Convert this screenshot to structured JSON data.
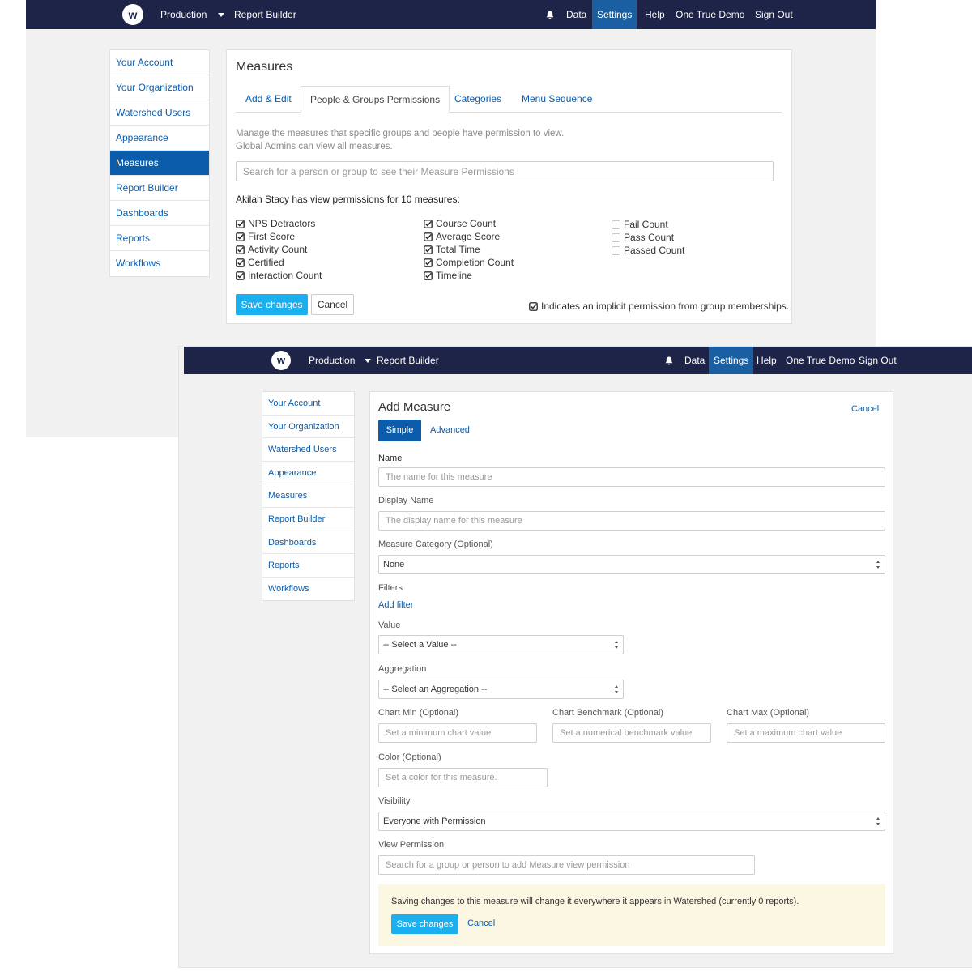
{
  "window1": {
    "navbar": {
      "logo": "w",
      "environment": "Production",
      "report_builder": "Report Builder",
      "data": "Data",
      "settings": "Settings",
      "help": "Help",
      "account": "One True Demo",
      "sign_out": "Sign Out"
    },
    "sidebar": {
      "items": [
        "Your Account",
        "Your Organization",
        "Watershed Users",
        "Appearance",
        "Measures",
        "Report Builder",
        "Dashboards",
        "Reports",
        "Workflows"
      ],
      "active": "Measures"
    },
    "panel": {
      "title": "Measures",
      "tabs": [
        "Add & Edit",
        "People & Groups Permissions",
        "Categories",
        "Menu Sequence"
      ],
      "active_tab": "People & Groups Permissions",
      "description_line1": "Manage the measures that specific groups and people have permission to view.",
      "description_line2": "Global Admins can view all measures.",
      "search_placeholder": "Search for a person or group to see their Measure Permissions",
      "summary": "Akilah Stacy has view permissions for 10 measures:",
      "columns": [
        {
          "items": [
            {
              "label": "NPS Detractors",
              "checked": true
            },
            {
              "label": "First Score",
              "checked": true
            },
            {
              "label": "Activity Count",
              "checked": true
            },
            {
              "label": "Certified",
              "checked": true
            },
            {
              "label": "Interaction Count",
              "checked": true
            }
          ]
        },
        {
          "items": [
            {
              "label": "Course Count",
              "checked": true
            },
            {
              "label": "Average Score",
              "checked": true
            },
            {
              "label": "Total Time",
              "checked": true
            },
            {
              "label": "Completion Count",
              "checked": true
            },
            {
              "label": "Timeline",
              "checked": true
            }
          ]
        },
        {
          "items": [
            {
              "label": "Fail Count",
              "checked": false
            },
            {
              "label": "Pass Count",
              "checked": false
            },
            {
              "label": "Passed Count",
              "checked": false
            }
          ]
        }
      ],
      "save_label": "Save changes",
      "cancel_label": "Cancel",
      "footnote": "Indicates an implicit permission from group memberships."
    }
  },
  "window2": {
    "navbar": {
      "logo": "w",
      "environment": "Production",
      "report_builder": "Report Builder",
      "data": "Data",
      "settings": "Settings",
      "help": "Help",
      "account": "One True Demo",
      "sign_out": "Sign Out"
    },
    "sidebar": {
      "items": [
        "Your Account",
        "Your Organization",
        "Watershed Users",
        "Appearance",
        "Measures",
        "Report Builder",
        "Dashboards",
        "Reports",
        "Workflows"
      ]
    },
    "form": {
      "title": "Add Measure",
      "cancel_top": "Cancel",
      "mode_simple": "Simple",
      "mode_advanced": "Advanced",
      "name_label": "Name",
      "name_placeholder": "The name for this measure",
      "display_name_label": "Display Name",
      "display_name_placeholder": "The display name for this measure",
      "category_label": "Measure Category (Optional)",
      "category_value": "None",
      "filters_label": "Filters",
      "add_filter": "Add filter",
      "value_label": "Value",
      "value_value": "-- Select a Value --",
      "aggregation_label": "Aggregation",
      "aggregation_value": "-- Select an Aggregation --",
      "chart_min_label": "Chart Min (Optional)",
      "chart_min_placeholder": "Set a minimum chart value",
      "chart_benchmark_label": "Chart Benchmark (Optional)",
      "chart_benchmark_placeholder": "Set a numerical benchmark value",
      "chart_max_label": "Chart Max (Optional)",
      "chart_max_placeholder": "Set a maximum chart value",
      "color_label": "Color (Optional)",
      "color_placeholder": "Set a color for this measure.",
      "visibility_label": "Visibility",
      "visibility_value": "Everyone with Permission",
      "view_permission_label": "View Permission",
      "view_permission_placeholder": "Search for a group or person to add Measure view permission",
      "notice": "Saving changes to this measure will change it everywhere it appears in Watershed (currently 0 reports).",
      "save_label": "Save changes",
      "cancel_bottom": "Cancel"
    }
  },
  "colors": {
    "navbar": "#1d2447",
    "active_nav": "#1b5fa3",
    "link": "#0b5cab",
    "primary_button": "#1ab0f0",
    "background": "#f1f1f1",
    "notice": "#fcf7e2"
  }
}
